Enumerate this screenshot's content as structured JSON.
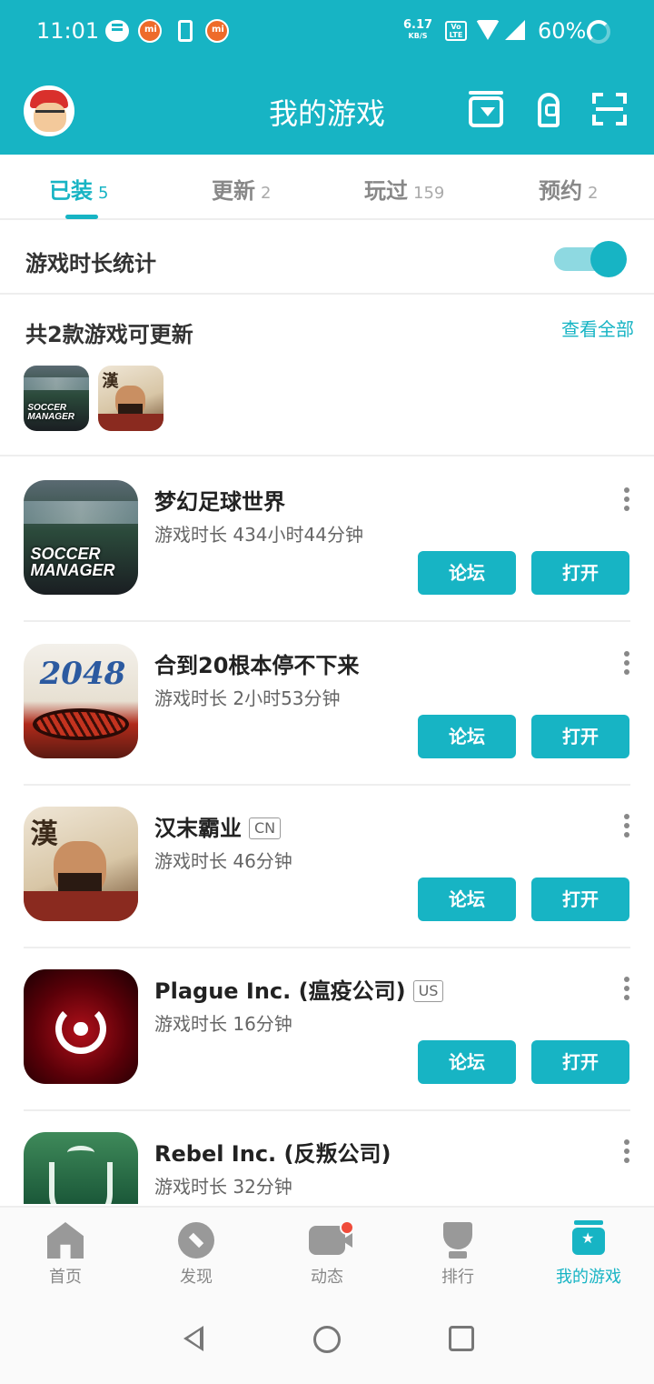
{
  "status_bar": {
    "time": "11:01",
    "net_speed": "6.17",
    "net_unit": "KB/S",
    "volte": "Vo LTE",
    "battery": "60%"
  },
  "header": {
    "title": "我的游戏"
  },
  "tabs": [
    {
      "label": "已装",
      "count": "5",
      "active": true
    },
    {
      "label": "更新",
      "count": "2",
      "active": false
    },
    {
      "label": "玩过",
      "count": "159",
      "active": false
    },
    {
      "label": "预约",
      "count": "2",
      "active": false
    }
  ],
  "stats": {
    "label": "游戏时长统计",
    "enabled": true
  },
  "updates": {
    "title": "共2款游戏可更新",
    "view_all": "查看全部",
    "icons": [
      "soccer-manager-icon",
      "han-dynasty-icon"
    ]
  },
  "games": [
    {
      "name": "梦幻足球世界",
      "region": "",
      "playtime": "游戏时长 434小时44分钟",
      "icon": "soccer-manager-icon",
      "icon_text": "SOCCER MANAGER"
    },
    {
      "name": "合到20根本停不下来",
      "region": "",
      "playtime": "游戏时长 2小时53分钟",
      "icon": "2048-icon",
      "icon_text": "2048"
    },
    {
      "name": "汉末霸业",
      "region": "CN",
      "playtime": "游戏时长 46分钟",
      "icon": "han-dynasty-icon",
      "icon_text": "漢"
    },
    {
      "name": "Plague Inc. (瘟疫公司)",
      "region": "US",
      "playtime": "游戏时长 16分钟",
      "icon": "plague-biohazard-icon"
    },
    {
      "name": "Rebel Inc. (反叛公司)",
      "region": "",
      "playtime": "游戏时长 32分钟",
      "icon": "rebel-shield-icon"
    }
  ],
  "game_buttons": {
    "forum": "论坛",
    "open": "打开"
  },
  "bottom_nav": [
    {
      "label": "首页",
      "icon": "home-icon",
      "active": false
    },
    {
      "label": "发现",
      "icon": "compass-icon",
      "active": false
    },
    {
      "label": "动态",
      "icon": "feed-camera-icon",
      "active": false,
      "badge": true
    },
    {
      "label": "排行",
      "icon": "trophy-icon",
      "active": false
    },
    {
      "label": "我的游戏",
      "icon": "my-games-icon",
      "active": true
    }
  ],
  "colors": {
    "accent": "#17b4c4",
    "badge": "#ef4b3a"
  }
}
